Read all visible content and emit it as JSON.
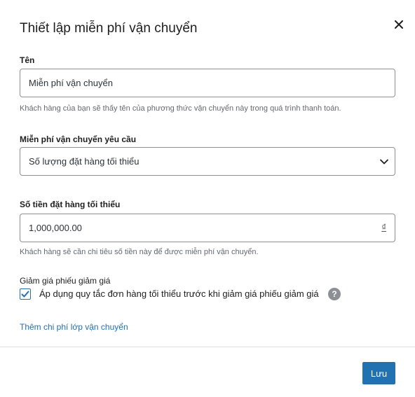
{
  "modal": {
    "title": "Thiết lập miễn phí vận chuyển"
  },
  "name_field": {
    "label": "Tên",
    "value": "Miễn phí vận chuyển",
    "help": "Khách hàng của bạn sẽ thấy tên của phương thức vận chuyển này trong quá trình thanh toán."
  },
  "requires_field": {
    "label": "Miễn phí vận chuyển yêu cầu",
    "selected": "Số lượng đặt hàng tối thiểu"
  },
  "min_amount_field": {
    "label": "Số tiền đặt hàng tối thiểu",
    "value": "1,000,000.00",
    "currency": "₫",
    "help": "Khách hàng sẽ cần chi tiêu số tiền này để được miễn phí vận chuyển."
  },
  "coupon_section": {
    "label": "Giảm giá phiếu giảm giá",
    "checkbox_label": "Áp dụng quy tắc đơn hàng tối thiểu trước khi giảm giá phiếu giảm giá",
    "checked": true,
    "help_icon_glyph": "?"
  },
  "add_class_cost_link": "Thêm chi phí lớp vận chuyển",
  "footer": {
    "save_label": "Lưu"
  },
  "colors": {
    "accent": "#2271b1",
    "border": "#8c8f94",
    "help_text": "#646970"
  }
}
